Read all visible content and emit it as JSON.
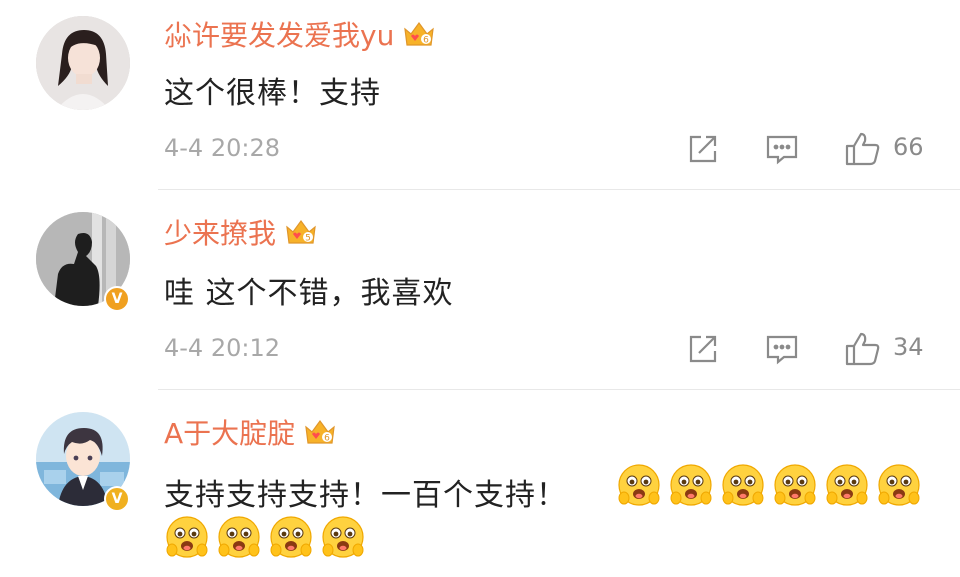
{
  "comments": [
    {
      "username": "尛许要发发爱我yu",
      "level": "6",
      "text": "这个很棒！支持",
      "time": "4-4 20:28",
      "likes": "66",
      "verified": false
    },
    {
      "username": "少来撩我",
      "level": "5",
      "text": "哇 这个不错，我喜欢",
      "time": "4-4 20:12",
      "likes": "34",
      "verified": true,
      "badge_color": "#f0a020"
    },
    {
      "username": "A于大腚腚",
      "level": "6",
      "text": "支持支持支持！一百个支持！",
      "verified": true,
      "badge_color": "#f0b020",
      "emoji_name": "smile-face-emoji"
    }
  ],
  "icons": {
    "repost": "share-icon",
    "comment": "comment-icon",
    "like": "thumbs-up-icon",
    "crown": "crown-icon"
  },
  "colors": {
    "username": "#eb7350",
    "text": "#222222",
    "meta": "#a8a8a8"
  }
}
